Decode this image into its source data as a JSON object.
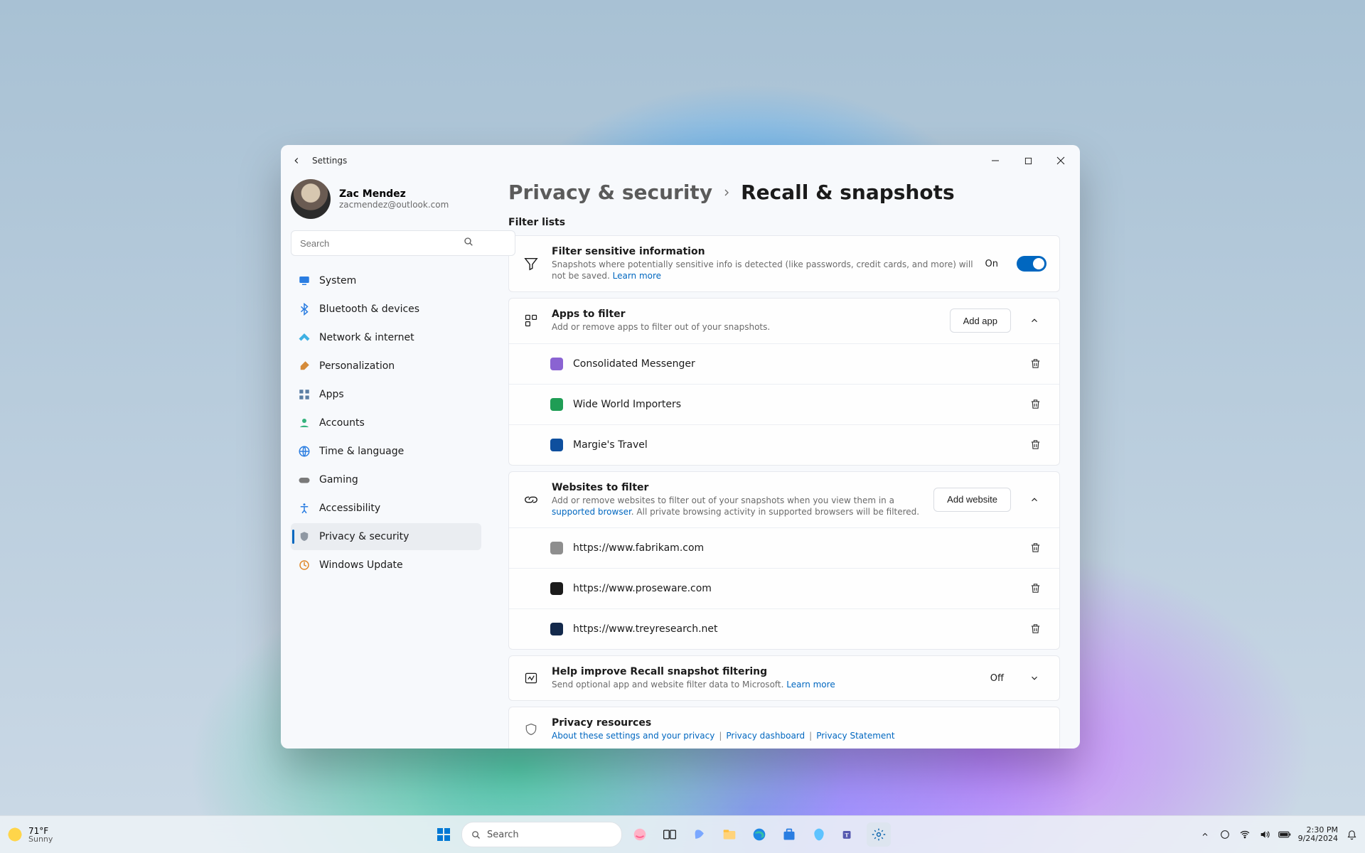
{
  "window": {
    "title": "Settings"
  },
  "user": {
    "name": "Zac Mendez",
    "email": "zacmendez@outlook.com"
  },
  "search": {
    "placeholder": "Search"
  },
  "sidebar": {
    "items": [
      {
        "label": "System",
        "icon": "display"
      },
      {
        "label": "Bluetooth & devices",
        "icon": "bluetooth"
      },
      {
        "label": "Network & internet",
        "icon": "wifi"
      },
      {
        "label": "Personalization",
        "icon": "brush"
      },
      {
        "label": "Apps",
        "icon": "apps"
      },
      {
        "label": "Accounts",
        "icon": "user"
      },
      {
        "label": "Time & language",
        "icon": "globe"
      },
      {
        "label": "Gaming",
        "icon": "gamepad"
      },
      {
        "label": "Accessibility",
        "icon": "accessibility"
      },
      {
        "label": "Privacy & security",
        "icon": "shield"
      },
      {
        "label": "Windows Update",
        "icon": "update"
      }
    ],
    "activeIndex": 9
  },
  "breadcrumb": {
    "root": "Privacy & security",
    "leaf": "Recall & snapshots"
  },
  "sectionTitle": "Filter lists",
  "filterSensitive": {
    "title": "Filter sensitive information",
    "desc": "Snapshots where potentially sensitive info is detected (like passwords, credit cards, and more) will not be saved. ",
    "learn": "Learn more",
    "state": "On",
    "on": true
  },
  "appsFilter": {
    "title": "Apps to filter",
    "desc": "Add or remove apps to filter out of your snapshots.",
    "addLabel": "Add app",
    "items": [
      {
        "name": "Consolidated Messenger",
        "color": "#8a63d2"
      },
      {
        "name": "Wide World Importers",
        "color": "#1f9d55"
      },
      {
        "name": "Margie's Travel",
        "color": "#0e4f9e"
      }
    ]
  },
  "websitesFilter": {
    "title": "Websites to filter",
    "descA": "Add or remove websites to filter out of your snapshots when you view them in a ",
    "link": "supported browser",
    "descB": ". All private browsing activity in supported browsers will be filtered.",
    "addLabel": "Add website",
    "items": [
      {
        "url": "https://www.fabrikam.com",
        "color": "#8e8e8e"
      },
      {
        "url": "https://www.proseware.com",
        "color": "#1b1b1b"
      },
      {
        "url": "https://www.treyresearch.net",
        "color": "#13294b"
      }
    ]
  },
  "helpImprove": {
    "title": "Help improve Recall snapshot filtering",
    "desc": "Send optional app and website filter data to Microsoft. ",
    "learn": "Learn more",
    "state": "Off"
  },
  "privacyResources": {
    "title": "Privacy resources",
    "links": [
      "About these settings and your privacy",
      "Privacy dashboard",
      "Privacy Statement"
    ]
  },
  "taskbar": {
    "weather": {
      "temp": "71°F",
      "cond": "Sunny"
    },
    "searchPlaceholder": "Search",
    "time": "2:30 PM",
    "date": "9/24/2024"
  }
}
